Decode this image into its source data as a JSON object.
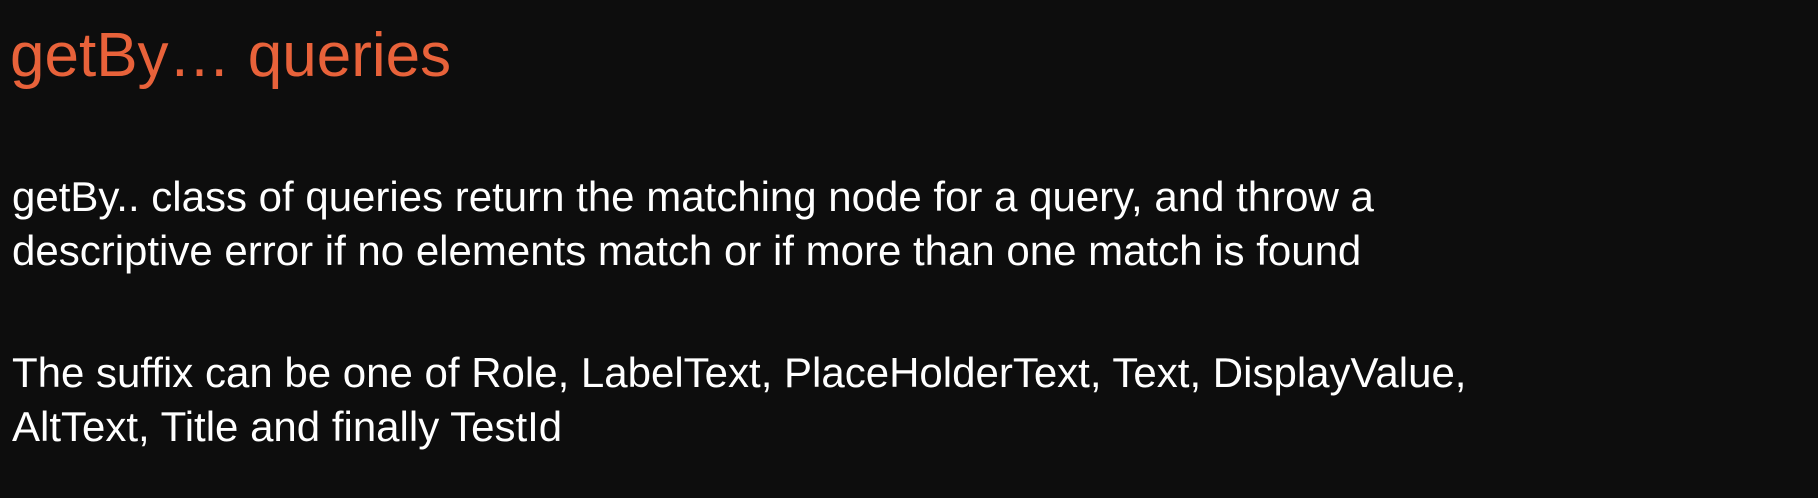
{
  "slide": {
    "title": "getBy… queries",
    "paragraphs": [
      {
        "lines": [
          "getBy.. class of queries return the matching node for a query, and throw a",
          "descriptive error if no elements match or if more than one match is found"
        ]
      },
      {
        "lines": [
          "The suffix can be one of Role, LabelText, PlaceHolderText, Text, DisplayValue,",
          "AltText, Title and finally TestId"
        ]
      }
    ],
    "colors": {
      "background": "#0d0d0d",
      "title": "#e8623a",
      "body_text": "#ffffff"
    }
  }
}
